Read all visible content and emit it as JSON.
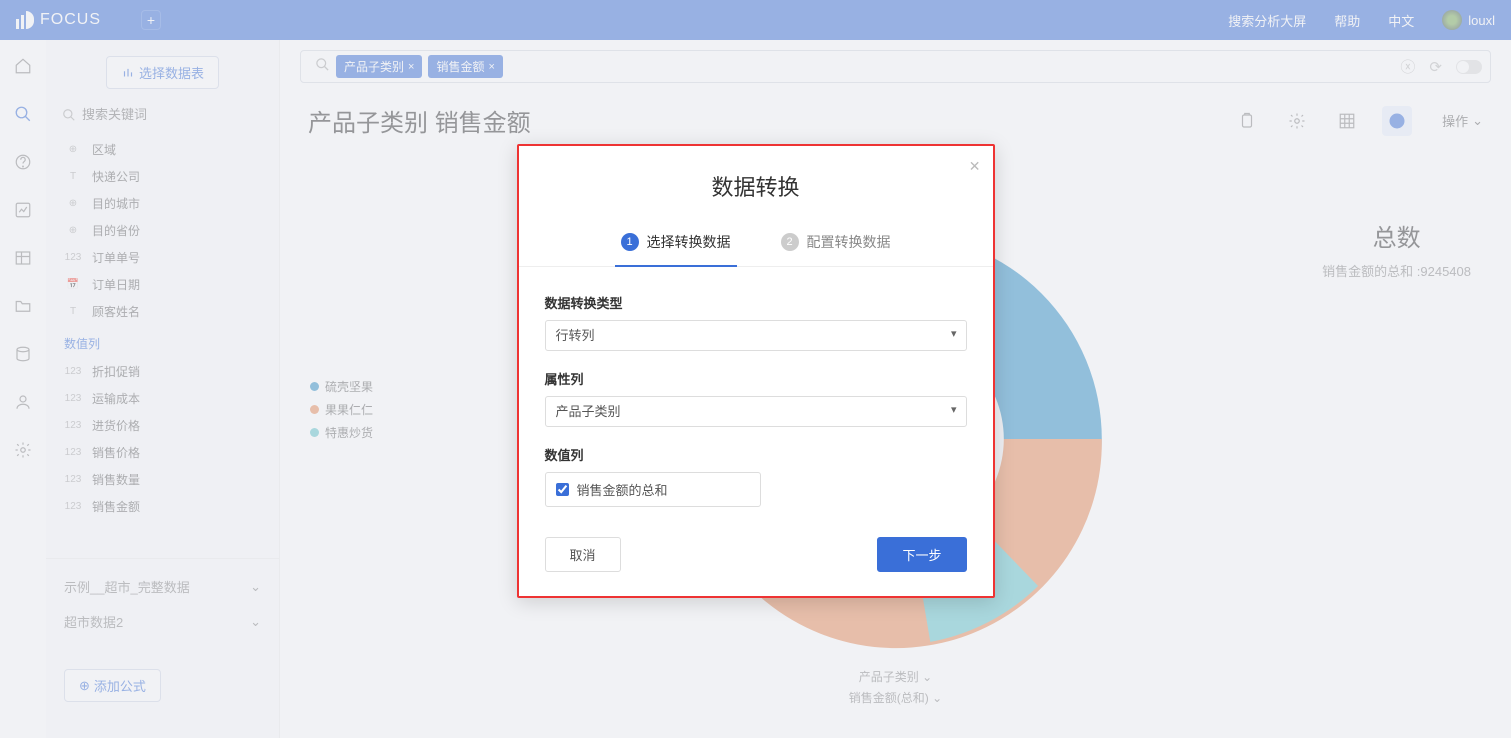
{
  "header": {
    "logo": "FOCUS",
    "search_screen": "搜索分析大屏",
    "help": "帮助",
    "lang": "中文",
    "user": "louxl"
  },
  "sidebar": {
    "select_table_btn": "选择数据表",
    "search_placeholder": "搜索关键词",
    "items": [
      {
        "type": "⊕",
        "label": "区域"
      },
      {
        "type": "T",
        "label": "快递公司"
      },
      {
        "type": "⊕",
        "label": "目的城市"
      },
      {
        "type": "⊕",
        "label": "目的省份"
      },
      {
        "type": "123",
        "label": "订单单号"
      },
      {
        "type": "📅",
        "label": "订单日期"
      },
      {
        "type": "T",
        "label": "顾客姓名"
      }
    ],
    "group_label": "数值列",
    "numeric_items": [
      {
        "type": "123",
        "label": "折扣促销"
      },
      {
        "type": "123",
        "label": "运输成本"
      },
      {
        "type": "123",
        "label": "进货价格"
      },
      {
        "type": "123",
        "label": "销售价格"
      },
      {
        "type": "123",
        "label": "销售数量"
      },
      {
        "type": "123",
        "label": "销售金额"
      }
    ],
    "foot1": "示例__超市_完整数据",
    "foot2": "超市数据2",
    "add_formula": "添加公式"
  },
  "query": {
    "chip1": "产品子类别",
    "chip2": "销售金额"
  },
  "main": {
    "title": "产品子类别 销售金额",
    "action": "操作",
    "legend": [
      {
        "color": "#2e8fc6",
        "label": "硫壳坚果"
      },
      {
        "color": "#e88d5a",
        "label": "果果仁仁"
      },
      {
        "color": "#5fc3c9",
        "label": "特惠炒货"
      }
    ],
    "total_label": "总数",
    "total_text": "销售金额的总和 :9245408",
    "axis1": "产品子类别",
    "axis2": "销售金额(总和)"
  },
  "modal": {
    "title": "数据转换",
    "step1": "选择转换数据",
    "step2": "配置转换数据",
    "field1_label": "数据转换类型",
    "field1_value": "行转列",
    "field2_label": "属性列",
    "field2_value": "产品子类别",
    "field3_label": "数值列",
    "check_label": "销售金额的总和",
    "cancel": "取消",
    "next": "下一步"
  },
  "chart_data": {
    "type": "pie",
    "title": "产品子类别 销售金额",
    "total": 9245408,
    "series": [
      {
        "name": "硫壳坚果",
        "value": 4530000,
        "color": "#2e8fc6"
      },
      {
        "name": "果果仁仁",
        "value": 3790000,
        "color": "#e88d5a"
      },
      {
        "name": "特惠炒货",
        "value": 925408,
        "color": "#5fc3c9"
      }
    ]
  }
}
